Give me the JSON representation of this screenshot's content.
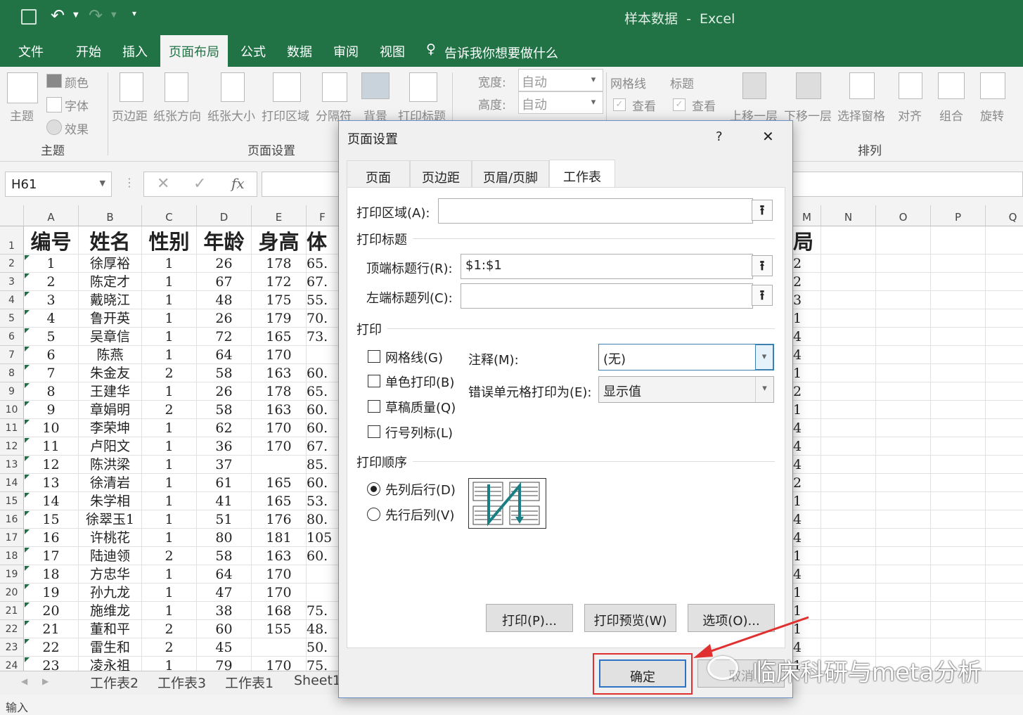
{
  "titlebar": {
    "title": "样本数据  -  Excel"
  },
  "menu": [
    "文件",
    "开始",
    "插入",
    "页面布局",
    "公式",
    "数据",
    "审阅",
    "视图"
  ],
  "tell_me": "告诉我你想要做什么",
  "ribbon": {
    "theme_main": "主题",
    "colors": "颜色",
    "fonts": "字体",
    "effects": "效果",
    "margins": "页边距",
    "orientation": "纸张方向",
    "size": "纸张大小",
    "print_area": "打印区域",
    "breaks": "分隔符",
    "background": "背景",
    "print_titles": "打印标题",
    "width_label": "宽度:",
    "width_value": "自动",
    "height_label": "高度:",
    "height_value": "自动",
    "gridlines": "网格线",
    "gridlines_view": "查看",
    "headings": "标题",
    "headings_view": "查看",
    "bring_forward": "上移一层",
    "send_backward": "下移一层",
    "selection_pane": "选择窗格",
    "align": "对齐",
    "group": "组合",
    "rotate": "旋转",
    "group_theme": "主题",
    "group_page_setup": "页面设置",
    "group_arrange": "排列"
  },
  "namebox": "H61",
  "columns": [
    "A",
    "B",
    "C",
    "D",
    "E",
    "F",
    "M",
    "N",
    "O",
    "P",
    "Q"
  ],
  "headers": [
    "编号",
    "姓名",
    "性别",
    "年龄",
    "身高",
    "体",
    "局"
  ],
  "rows": [
    [
      "1",
      "徐厚裕",
      "1",
      "26",
      "178",
      "65.",
      "2"
    ],
    [
      "2",
      "陈定才",
      "1",
      "67",
      "172",
      "67.",
      "2"
    ],
    [
      "3",
      "戴晓江",
      "1",
      "48",
      "175",
      "55.",
      "3"
    ],
    [
      "4",
      "鲁开英",
      "1",
      "26",
      "179",
      "70.",
      "1"
    ],
    [
      "5",
      "吴章信",
      "1",
      "72",
      "165",
      "73.",
      "4"
    ],
    [
      "6",
      "陈燕",
      "1",
      "64",
      "170",
      "",
      "4"
    ],
    [
      "7",
      "朱金友",
      "2",
      "58",
      "163",
      "60.",
      "1"
    ],
    [
      "8",
      "王建华",
      "1",
      "26",
      "178",
      "65.",
      "2"
    ],
    [
      "9",
      "章娟明",
      "2",
      "58",
      "163",
      "60.",
      "1"
    ],
    [
      "10",
      "李荣坤",
      "1",
      "62",
      "170",
      "60.",
      "4"
    ],
    [
      "11",
      "卢阳文",
      "1",
      "36",
      "170",
      "67.",
      "4"
    ],
    [
      "12",
      "陈洪梁",
      "1",
      "37",
      "",
      "85.",
      "4"
    ],
    [
      "13",
      "徐清岩",
      "1",
      "61",
      "165",
      "60.",
      "2"
    ],
    [
      "14",
      "朱学相",
      "1",
      "41",
      "165",
      "53.",
      "1"
    ],
    [
      "15",
      "徐翠玉1",
      "1",
      "51",
      "176",
      "80.",
      "4"
    ],
    [
      "16",
      "许桃花",
      "1",
      "80",
      "181",
      "105",
      "4"
    ],
    [
      "17",
      "陆迪领",
      "2",
      "58",
      "163",
      "60.",
      "1"
    ],
    [
      "18",
      "方忠华",
      "1",
      "64",
      "170",
      "",
      "4"
    ],
    [
      "19",
      "孙九龙",
      "1",
      "47",
      "170",
      "",
      "1"
    ],
    [
      "20",
      "施维龙",
      "1",
      "38",
      "168",
      "75.",
      "1"
    ],
    [
      "21",
      "董和平",
      "2",
      "60",
      "155",
      "48.",
      "1"
    ],
    [
      "22",
      "雷生和",
      "2",
      "45",
      "",
      "50.",
      "4"
    ],
    [
      "23",
      "凌永祖",
      "1",
      "79",
      "170",
      "75.",
      "1"
    ]
  ],
  "sheet_tabs": [
    "工作表2",
    "工作表3",
    "工作表1",
    "Sheet1"
  ],
  "status": "输入",
  "dialog": {
    "title": "页面设置",
    "help": "?",
    "close": "✕",
    "tabs": [
      "页面",
      "页边距",
      "页眉/页脚",
      "工作表"
    ],
    "print_area_label": "打印区域(A):",
    "print_titles_section": "打印标题",
    "top_rows_label": "顶端标题行(R):",
    "top_rows_value": "$1:$1",
    "left_cols_label": "左端标题列(C):",
    "print_section": "打印",
    "gridlines": "网格线(G)",
    "bw": "单色打印(B)",
    "draft": "草稿质量(Q)",
    "rowcol": "行号列标(L)",
    "comments_label": "注释(M):",
    "comments_value": "(无)",
    "errors_label": "错误单元格打印为(E):",
    "errors_value": "显示值",
    "order_section": "打印顺序",
    "down_over": "先列后行(D)",
    "over_down": "先行后列(V)",
    "print_btn": "打印(P)...",
    "preview_btn": "打印预览(W)",
    "options_btn": "选项(O)...",
    "ok_btn": "确定",
    "cancel_btn": "取消"
  },
  "watermark": "临床科研与meta分析",
  "accent": "#217346",
  "highlight": "#e03030"
}
